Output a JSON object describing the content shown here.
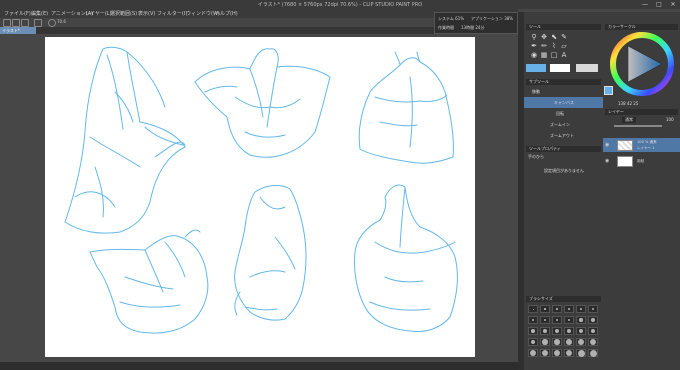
{
  "window": {
    "title": "イラスト* (7680 × 5760px 72dpi 70.6%) - CLIP STUDIO PAINT PRO",
    "minimize": "—",
    "maximize": "□",
    "close": "✕"
  },
  "menu": [
    "ファイル(F)",
    "編集(E)",
    "アニメーション(A)",
    "レイヤー(L)",
    "選択範囲(S)",
    "表示(V)",
    "フィルター(I)",
    "ウィンドウ(W)",
    "ヘルプ(H)"
  ],
  "document_tab": "イラスト*",
  "toolbar": {
    "zoom": "70.6"
  },
  "info_panel": {
    "line1_label": "システム 61%",
    "line1_value": "アプリケーション 38%",
    "line2_label": "作業時間",
    "line2_value": "13時間 24分"
  },
  "tool_panel": {
    "title": "ツール",
    "subtool_title": "サブツール",
    "items": [
      "移動",
      "キャンバス",
      "回転",
      "ズームイン",
      "ズームアウト"
    ]
  },
  "tool_property": {
    "title": "ツールプロパティ",
    "name": "手のひら",
    "message": "設定項目がありません"
  },
  "brush_size": {
    "title": "ブラシサイズ"
  },
  "color_wheel": {
    "title": "カラーサークル",
    "value": "138 42 25"
  },
  "layer_panel": {
    "title": "レイヤー",
    "blend_mode": "通常",
    "opacity": "100",
    "layers": [
      {
        "name": "100 % 通常",
        "sub": "レイヤー 1"
      },
      {
        "name": "用紙",
        "sub": ""
      }
    ]
  },
  "colors": {
    "accent": "#4f78a6",
    "sketch": "#63b8e8",
    "canvas": "#ffffff"
  }
}
